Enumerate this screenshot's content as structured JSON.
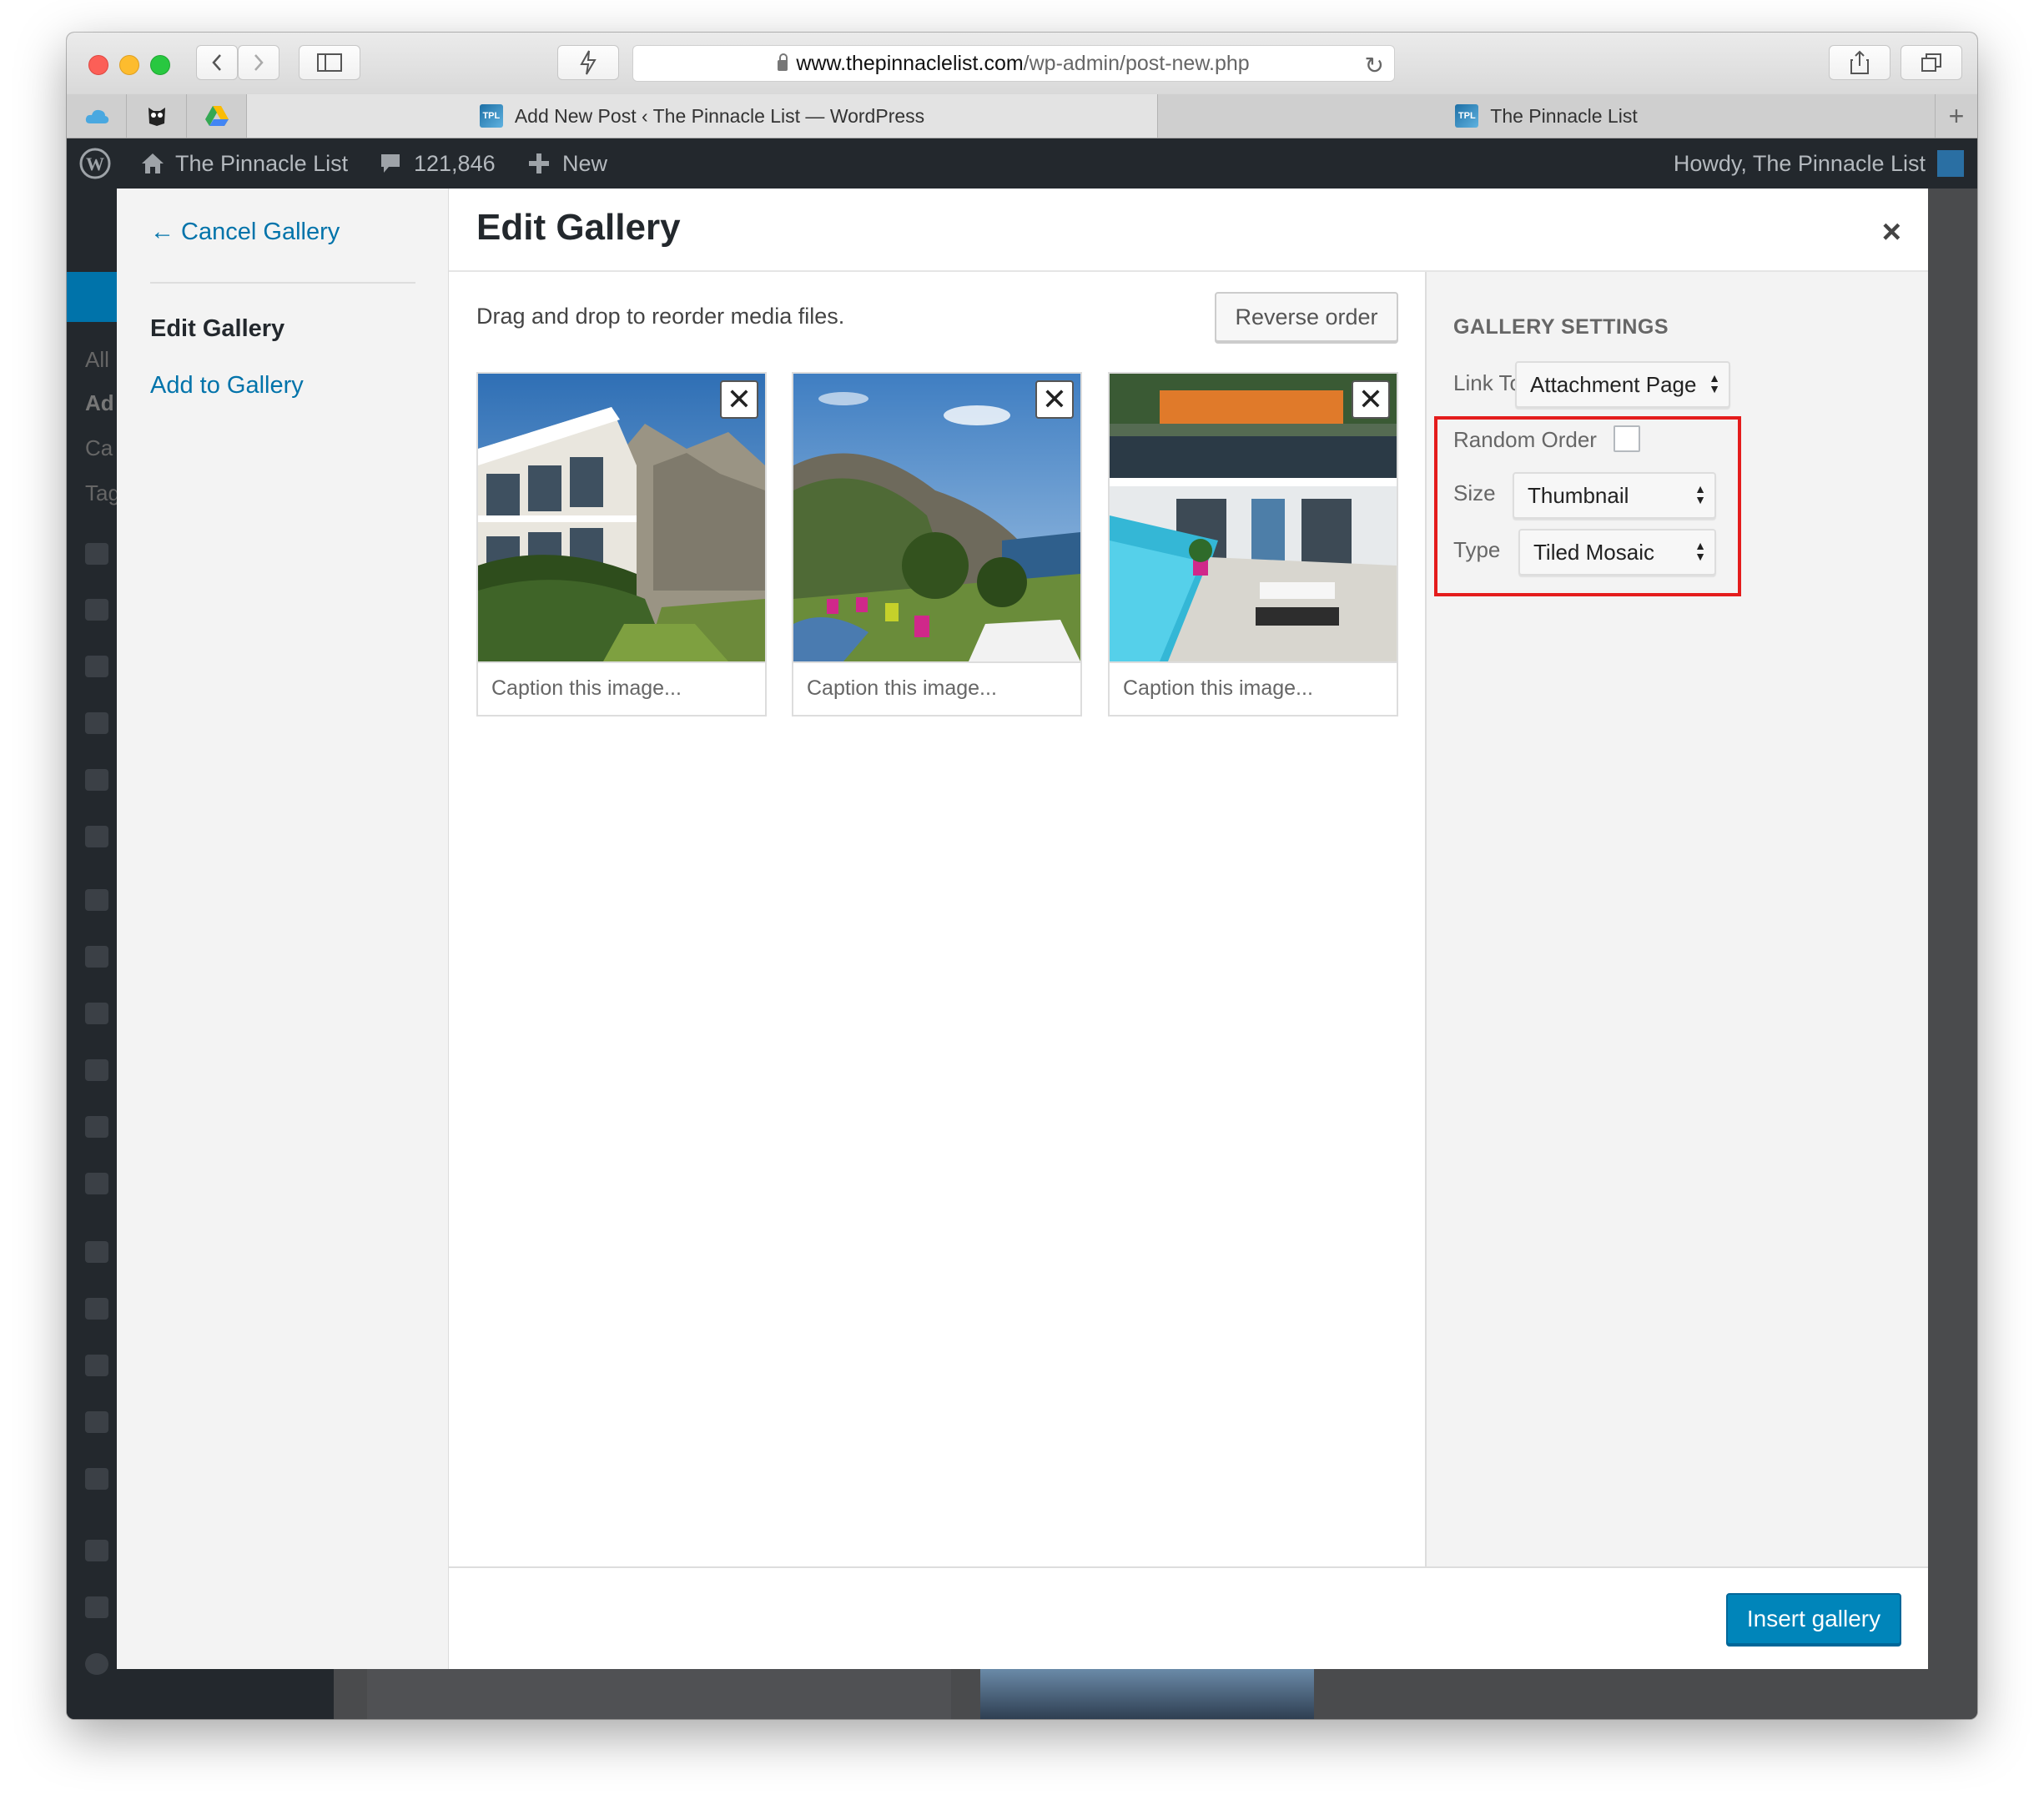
{
  "browser": {
    "url_host": "www.thepinnaclelist.com",
    "url_path": "/wp-admin/post-new.php",
    "tabs": [
      {
        "label": "Add New Post ‹ The Pinnacle List — WordPress",
        "active": true
      },
      {
        "label": "The Pinnacle List",
        "active": false
      }
    ],
    "favicon_text": "TPL"
  },
  "admin_bar": {
    "site_name": "The Pinnacle List",
    "comments_count": "121,846",
    "new_label": "New",
    "howdy": "Howdy, The Pinnacle List"
  },
  "background_menu": [
    "All",
    "Ad",
    "Ca",
    "Tag"
  ],
  "modal": {
    "menu": {
      "cancel": "← Cancel Gallery",
      "active_item": "Edit Gallery",
      "item": "Add to Gallery"
    },
    "title": "Edit Gallery",
    "close_symbol": "×",
    "instructions": "Drag and drop to reorder media files.",
    "reverse_button": "Reverse order",
    "images": [
      {
        "caption_placeholder": "Caption this image...",
        "remove_symbol": "✕",
        "scene": "villa-garden"
      },
      {
        "caption_placeholder": "Caption this image...",
        "remove_symbol": "✕",
        "scene": "coastline"
      },
      {
        "caption_placeholder": "Caption this image...",
        "remove_symbol": "✕",
        "scene": "pool-terrace"
      }
    ],
    "settings": {
      "heading": "GALLERY SETTINGS",
      "link_to_label": "Link To",
      "link_to_value": "Attachment Page",
      "random_order_label": "Random Order",
      "random_order_checked": false,
      "size_label": "Size",
      "size_value": "Thumbnail",
      "type_label": "Type",
      "type_value": "Tiled Mosaic"
    },
    "insert_button": "Insert gallery"
  },
  "colors": {
    "link": "#0073aa",
    "primary_button": "#0085ba",
    "highlight_box": "#e41c1c",
    "admin_bar": "#23282d"
  }
}
